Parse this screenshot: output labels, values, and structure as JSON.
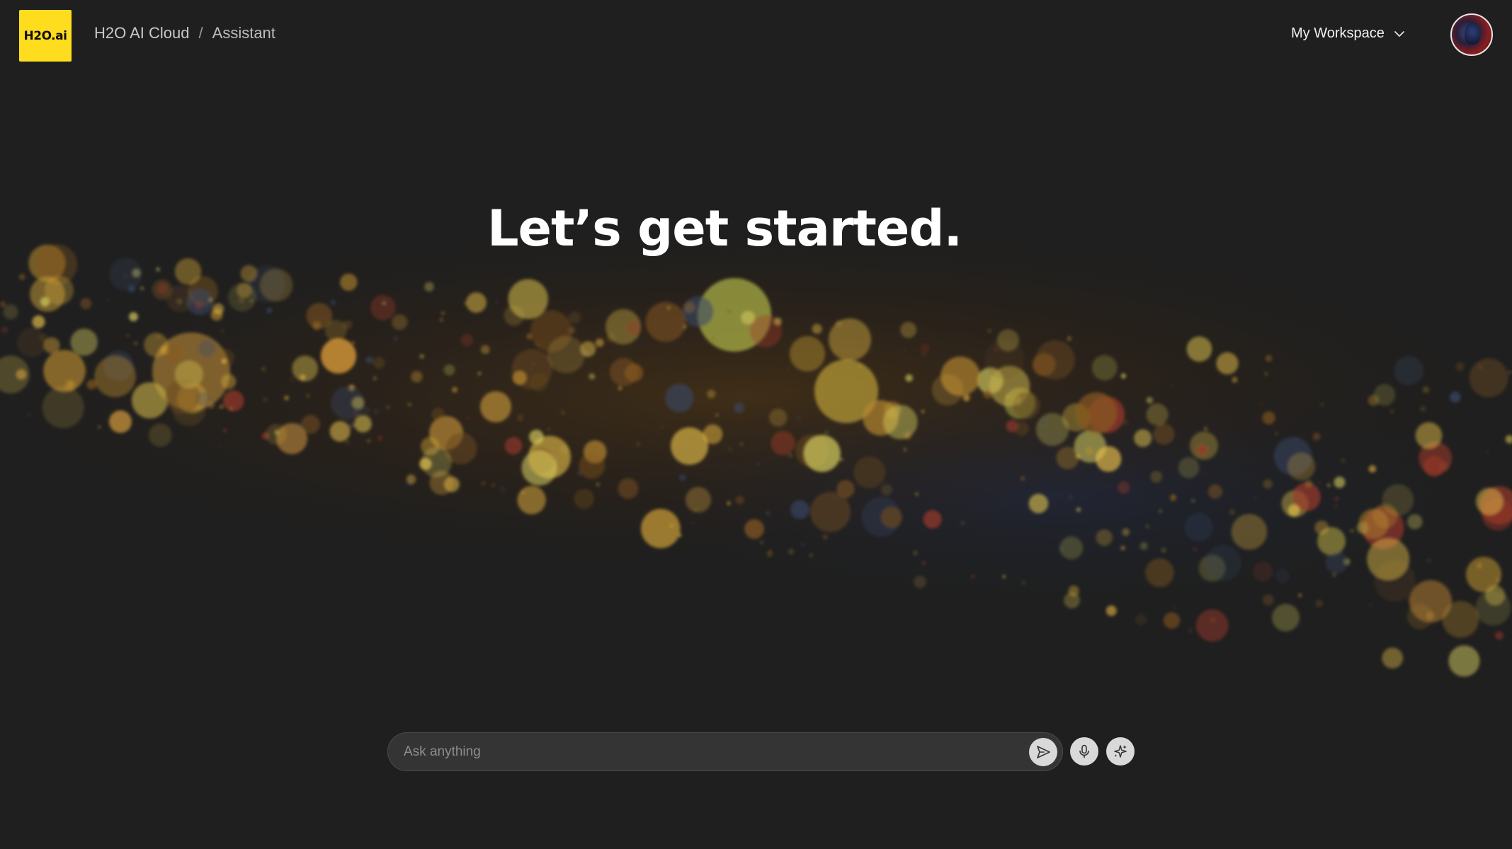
{
  "header": {
    "logo_text": "H2O.ai",
    "breadcrumb": [
      "H2O AI Cloud",
      "Assistant"
    ],
    "breadcrumb_separator": "/",
    "workspace_label": "My Workspace"
  },
  "main": {
    "headline": "Let’s get started."
  },
  "composer": {
    "placeholder": "Ask anything"
  },
  "icons": {
    "workspace_dropdown": "chevron-down-icon",
    "send": "send-icon",
    "voice": "microphone-icon",
    "magic": "sparkle-icon",
    "user": "avatar"
  },
  "colors": {
    "background": "#1f1f1f",
    "brand": "#fedd1f",
    "composer_bg": "#343434",
    "icon_button_bg": "#d9d9d9"
  }
}
